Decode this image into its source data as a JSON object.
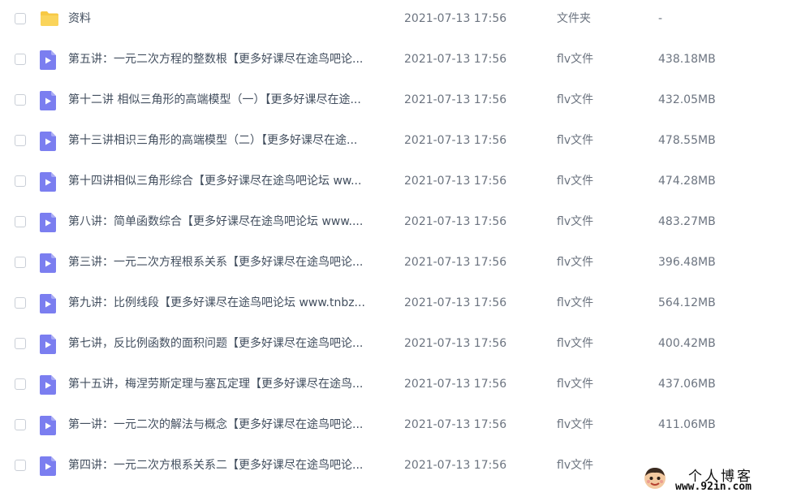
{
  "files": [
    {
      "icon": "folder-icon",
      "name": "资料",
      "date": "2021-07-13 17:56",
      "type": "文件夹",
      "size": "-"
    },
    {
      "icon": "video-file-icon",
      "name": "第五讲：一元二次方程的整数根【更多好课尽在途鸟吧论...",
      "date": "2021-07-13 17:56",
      "type": "flv文件",
      "size": "438.18MB"
    },
    {
      "icon": "video-file-icon",
      "name": "第十二讲 相似三角形的高端模型（一）【更多好课尽在途...",
      "date": "2021-07-13 17:56",
      "type": "flv文件",
      "size": "432.05MB"
    },
    {
      "icon": "video-file-icon",
      "name": "第十三讲相识三角形的高端模型（二）【更多好课尽在途...",
      "date": "2021-07-13 17:56",
      "type": "flv文件",
      "size": "478.55MB"
    },
    {
      "icon": "video-file-icon",
      "name": "第十四讲相似三角形综合【更多好课尽在途鸟吧论坛 ww...",
      "date": "2021-07-13 17:56",
      "type": "flv文件",
      "size": "474.28MB"
    },
    {
      "icon": "video-file-icon",
      "name": "第八讲：简单函数综合【更多好课尽在途鸟吧论坛 www....",
      "date": "2021-07-13 17:56",
      "type": "flv文件",
      "size": "483.27MB"
    },
    {
      "icon": "video-file-icon",
      "name": "第三讲：一元二次方程根系关系【更多好课尽在途鸟吧论...",
      "date": "2021-07-13 17:56",
      "type": "flv文件",
      "size": "396.48MB"
    },
    {
      "icon": "video-file-icon",
      "name": "第九讲：比例线段【更多好课尽在途鸟吧论坛 www.tnbz...",
      "date": "2021-07-13 17:56",
      "type": "flv文件",
      "size": "564.12MB"
    },
    {
      "icon": "video-file-icon",
      "name": "第七讲，反比例函数的面积问题【更多好课尽在途鸟吧论...",
      "date": "2021-07-13 17:56",
      "type": "flv文件",
      "size": "400.42MB"
    },
    {
      "icon": "video-file-icon",
      "name": "第十五讲，梅涅劳斯定理与塞瓦定理【更多好课尽在途鸟...",
      "date": "2021-07-13 17:56",
      "type": "flv文件",
      "size": "437.06MB"
    },
    {
      "icon": "video-file-icon",
      "name": "第一讲：一元二次的解法与概念【更多好课尽在途鸟吧论...",
      "date": "2021-07-13 17:56",
      "type": "flv文件",
      "size": "411.06MB"
    },
    {
      "icon": "video-file-icon",
      "name": "第四讲：一元二次方根系关系二【更多好课尽在途鸟吧论...",
      "date": "2021-07-13 17:56",
      "type": "flv文件",
      "size": ""
    }
  ],
  "watermark": {
    "title": "个人博客",
    "url": "www.92in.com"
  },
  "colors": {
    "folder": "#f7c944",
    "video_file": "#7b7ef0",
    "checkbox_border": "#c9ced6"
  }
}
